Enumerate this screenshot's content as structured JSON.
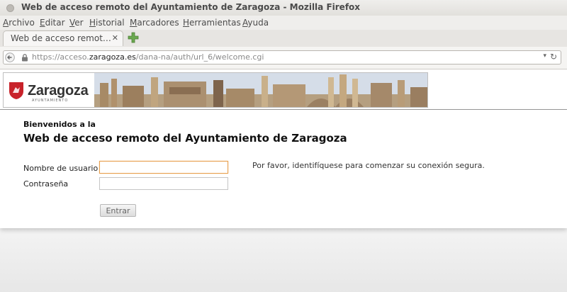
{
  "window": {
    "title": "Web de acceso remoto del Ayuntamiento de Zaragoza - Mozilla Firefox"
  },
  "menu": {
    "items": [
      "Archivo",
      "Editar",
      "Ver",
      "Historial",
      "Marcadores",
      "Herramientas",
      "Ayuda"
    ]
  },
  "tab": {
    "label": "Web de acceso remot…"
  },
  "urlbar": {
    "scheme": "https://acceso.",
    "host": "zaragoza.es",
    "path": "/dana-na/auth/url_6/welcome.cgi"
  },
  "banner": {
    "logo_text": "Zaragoza",
    "logo_sub": "AYUNTAMIENTO",
    "colors": {
      "shield": "#c8222a"
    }
  },
  "login": {
    "welcome_small": "Bienvenidos a la",
    "welcome_title": "Web de acceso remoto del Ayuntamiento de Zaragoza",
    "username_label": "Nombre de usuario",
    "password_label": "Contraseña",
    "username_value": "",
    "password_value": "",
    "hint": "Por favor, identifíquese para comenzar su conexión segura.",
    "submit_label": "Entrar"
  }
}
